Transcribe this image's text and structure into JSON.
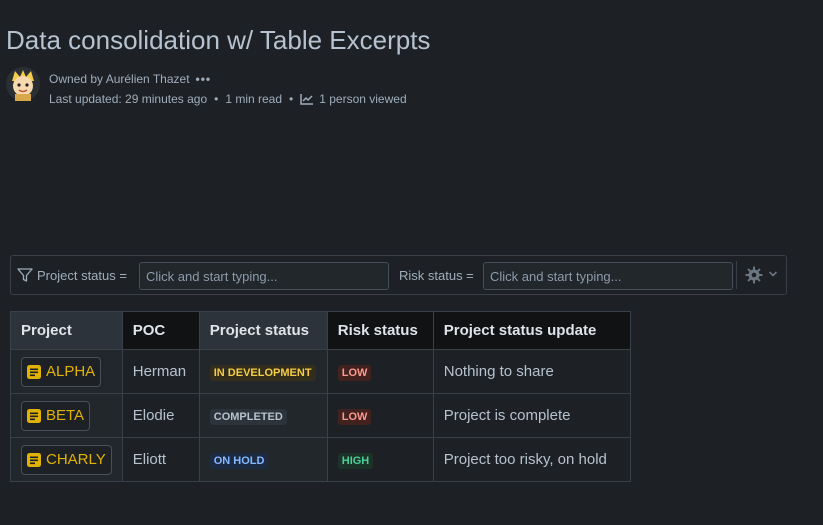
{
  "page": {
    "title": "Data consolidation w/ Table Excerpts"
  },
  "byline": {
    "owner_text": "Owned by Aurélien Thazet",
    "more_label": "•••",
    "last_updated": "Last updated: 29 minutes ago",
    "read_time": "1 min read",
    "viewers": "1 person viewed",
    "separator": "•"
  },
  "filters": {
    "project_status_label": "Project status =",
    "project_status_placeholder": "Click and start typing...",
    "risk_status_label": "Risk status =",
    "risk_status_placeholder": "Click and start typing..."
  },
  "table": {
    "headers": [
      "Project",
      "POC",
      "Project status",
      "Risk status",
      "Project status update"
    ],
    "rows": [
      {
        "project": "ALPHA",
        "poc": "Herman",
        "project_status": "IN DEVELOPMENT",
        "risk_status": "LOW",
        "update": "Nothing to share"
      },
      {
        "project": "BETA",
        "poc": "Elodie",
        "project_status": "COMPLETED",
        "risk_status": "LOW",
        "update": "Project is complete"
      },
      {
        "project": "CHARLY",
        "poc": "Eliott",
        "project_status": "ON HOLD",
        "risk_status": "HIGH",
        "update": "Project too risky, on hold"
      }
    ]
  },
  "colors": {
    "background": "#1d2125",
    "project_link": "#e2b203",
    "status_in_development_bg": "#332e1b",
    "status_in_development_fg": "#f5cd47",
    "status_completed_bg": "#2c333a",
    "status_completed_fg": "#b6c2cf",
    "status_on_hold_bg": "#1c2b41",
    "status_on_hold_fg": "#85b8ff",
    "risk_low_bg": "#42221f",
    "risk_low_fg": "#fd9891",
    "risk_high_bg": "#1c3329",
    "risk_high_fg": "#4bce97"
  },
  "icons": {
    "avatar": "cartoon-avatar",
    "viewers": "line-chart-icon",
    "filter": "funnel-icon",
    "settings": "gear-icon",
    "dropdown": "chevron-down-icon",
    "project": "page-icon"
  }
}
